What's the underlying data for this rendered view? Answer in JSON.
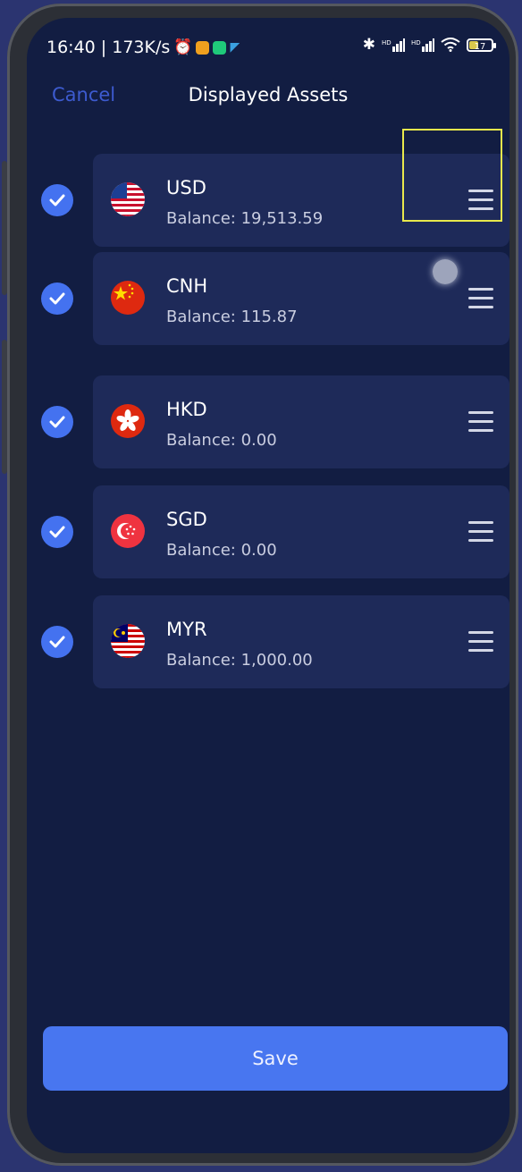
{
  "status_bar": {
    "time_speed": "16:40 | 173K/s",
    "battery": "17"
  },
  "nav": {
    "cancel_label": "Cancel",
    "title": "Displayed Assets"
  },
  "assets": [
    {
      "code": "USD",
      "balance": "Balance: 19,513.59",
      "checked": true
    },
    {
      "code": "CNH",
      "balance": "Balance: 115.87",
      "checked": true
    },
    {
      "code": "HKD",
      "balance": "Balance: 0.00",
      "checked": true
    },
    {
      "code": "SGD",
      "balance": "Balance: 0.00",
      "checked": true
    },
    {
      "code": "MYR",
      "balance": "Balance: 1,000.00",
      "checked": true
    }
  ],
  "save_label": "Save",
  "colors": {
    "accent": "#4472f0",
    "background": "#121d42",
    "card": "#1e2a59",
    "highlight": "#e8e84c"
  },
  "icons": {
    "check": "check-icon",
    "drag": "drag-handle-icon",
    "flags": [
      "us-flag-icon",
      "cn-flag-icon",
      "hk-flag-icon",
      "sg-flag-icon",
      "my-flag-icon"
    ]
  }
}
